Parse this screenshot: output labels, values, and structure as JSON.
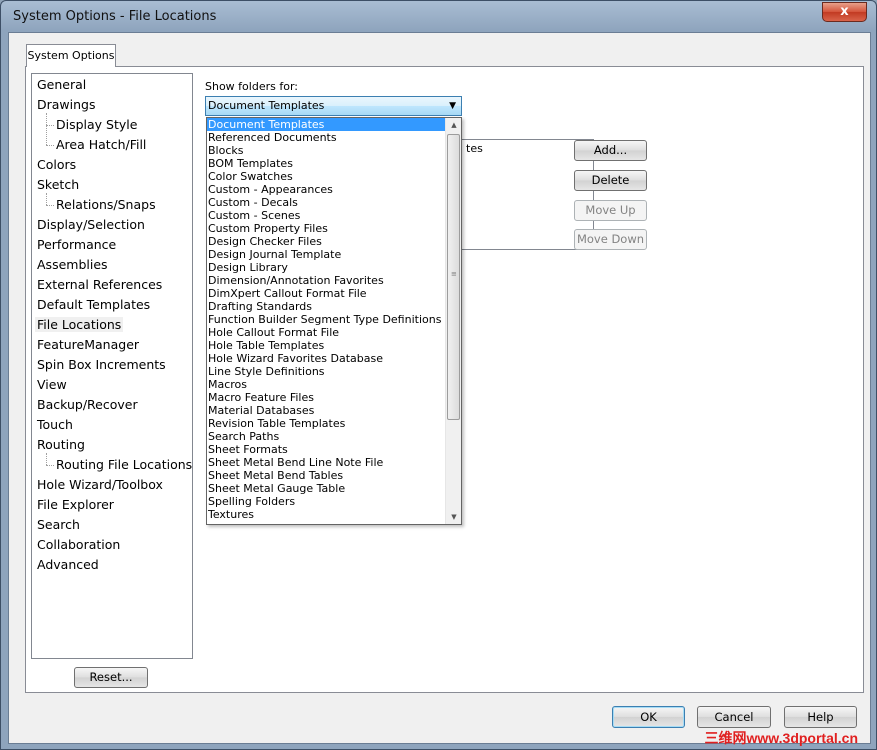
{
  "window": {
    "title": "System Options - File Locations",
    "close_glyph": "x"
  },
  "tab": {
    "label": "System Options"
  },
  "tree": {
    "items": [
      {
        "label": "General",
        "level": 0
      },
      {
        "label": "Drawings",
        "level": 0
      },
      {
        "label": "Display Style",
        "level": 1
      },
      {
        "label": "Area Hatch/Fill",
        "level": 1
      },
      {
        "label": "Colors",
        "level": 0
      },
      {
        "label": "Sketch",
        "level": 0
      },
      {
        "label": "Relations/Snaps",
        "level": 1
      },
      {
        "label": "Display/Selection",
        "level": 0
      },
      {
        "label": "Performance",
        "level": 0
      },
      {
        "label": "Assemblies",
        "level": 0
      },
      {
        "label": "External References",
        "level": 0
      },
      {
        "label": "Default Templates",
        "level": 0
      },
      {
        "label": "File Locations",
        "level": 0,
        "selected": true
      },
      {
        "label": "FeatureManager",
        "level": 0
      },
      {
        "label": "Spin Box Increments",
        "level": 0
      },
      {
        "label": "View",
        "level": 0
      },
      {
        "label": "Backup/Recover",
        "level": 0
      },
      {
        "label": "Touch",
        "level": 0
      },
      {
        "label": "Routing",
        "level": 0
      },
      {
        "label": "Routing File Locations",
        "level": 1
      },
      {
        "label": "Hole Wizard/Toolbox",
        "level": 0
      },
      {
        "label": "File Explorer",
        "level": 0
      },
      {
        "label": "Search",
        "level": 0
      },
      {
        "label": "Collaboration",
        "level": 0
      },
      {
        "label": "Advanced",
        "level": 0
      }
    ]
  },
  "reset_button": "Reset...",
  "show_folders": {
    "label": "Show folders for:",
    "selected": "Document Templates",
    "arrow": "▼"
  },
  "folders_list": {
    "visible_fragment": "tes"
  },
  "side_buttons": {
    "add": "Add...",
    "delete": "Delete",
    "move_up": "Move Up",
    "move_down": "Move Down"
  },
  "dropdown": {
    "options": [
      "Document Templates",
      "Referenced Documents",
      "Blocks",
      "BOM Templates",
      "Color Swatches",
      "Custom - Appearances",
      "Custom - Decals",
      "Custom - Scenes",
      "Custom Property Files",
      "Design Checker Files",
      "Design Journal Template",
      "Design Library",
      "Dimension/Annotation Favorites",
      "DimXpert Callout Format File",
      "Drafting Standards",
      "Function Builder Segment Type Definitions",
      "Hole Callout Format File",
      "Hole Table Templates",
      "Hole Wizard Favorites Database",
      "Line Style Definitions",
      "Macros",
      "Macro Feature Files",
      "Material Databases",
      "Revision Table Templates",
      "Search Paths",
      "Sheet Formats",
      "Sheet Metal Bend Line Note File",
      "Sheet Metal Bend Tables",
      "Sheet Metal Gauge Table",
      "Spelling Folders",
      "Textures"
    ],
    "selected_index": 0,
    "scroll_up": "▲",
    "scroll_down": "▼",
    "grip": "≡"
  },
  "footer": {
    "ok": "OK",
    "cancel": "Cancel",
    "help": "Help"
  },
  "watermark": "三维网www.3dportal.cn"
}
